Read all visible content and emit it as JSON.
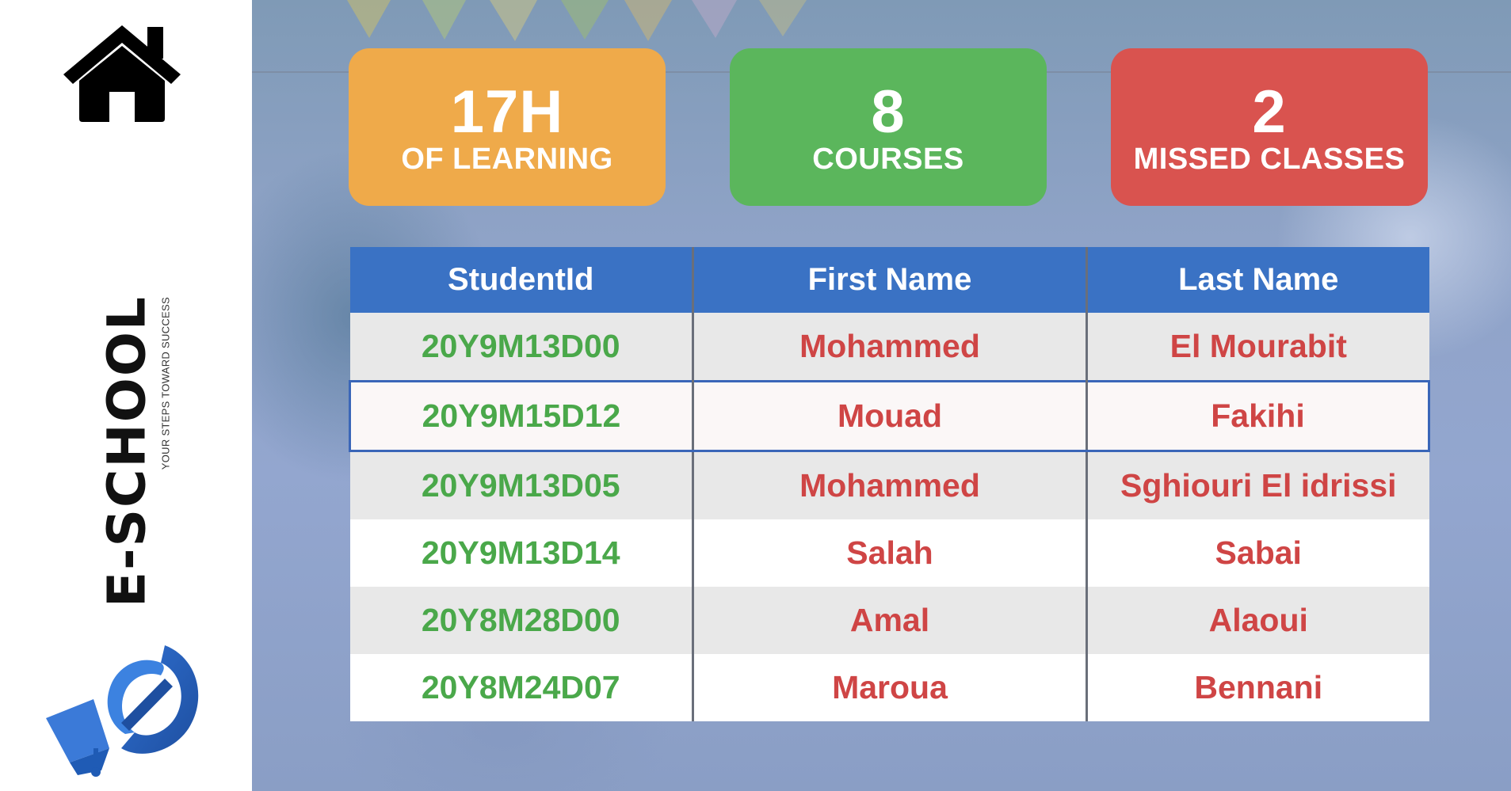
{
  "sidebar": {
    "home_icon": "home-icon",
    "brand": {
      "name": "E-SCHOOL",
      "tagline": "YOUR STEPS TOWARD SUCCESS",
      "logo_icon": "e-school-logo"
    }
  },
  "stats": [
    {
      "value": "17H",
      "label": "OF LEARNING",
      "color": "#efaa4a"
    },
    {
      "value": "8",
      "label": "COURSES",
      "color": "#5bb65c"
    },
    {
      "value": "2",
      "label": "MISSED CLASSES",
      "color": "#d9534f"
    }
  ],
  "table": {
    "headers": [
      "StudentId",
      "First Name",
      "Last Name"
    ],
    "header_color": "#3a72c4",
    "id_color": "#4aa84a",
    "name_color": "#cf4545",
    "rows": [
      {
        "id": "20Y9M13D00",
        "first_name": "Mohammed",
        "last_name": "El Mourabit"
      },
      {
        "id": "20Y9M15D12",
        "first_name": "Mouad",
        "last_name": "Fakihi",
        "selected": true
      },
      {
        "id": "20Y9M13D05",
        "first_name": "Mohammed",
        "last_name": "Sghiouri El idrissi"
      },
      {
        "id": "20Y9M13D14",
        "first_name": "Salah",
        "last_name": "Sabai"
      },
      {
        "id": "20Y8M28D00",
        "first_name": "Amal",
        "last_name": "Alaoui"
      },
      {
        "id": "20Y8M24D07",
        "first_name": "Maroua",
        "last_name": "Bennani"
      }
    ]
  }
}
